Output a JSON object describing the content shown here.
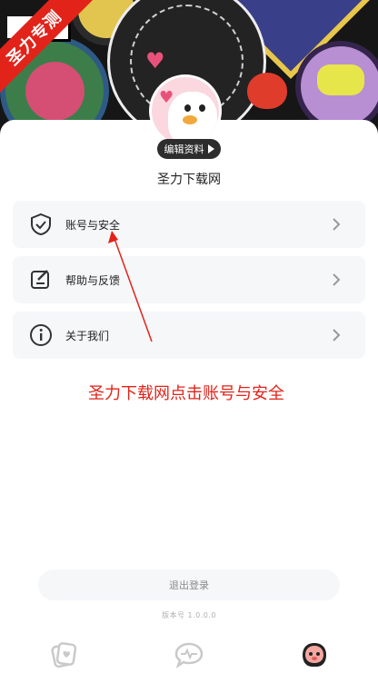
{
  "watermark": {
    "text": "圣力专测",
    "color": "#e2231a"
  },
  "profile": {
    "edit_label": "编辑资料",
    "username": "圣力下载网"
  },
  "menu": [
    {
      "label": "账号与安全",
      "icon": "shield-icon"
    },
    {
      "label": "帮助与反馈",
      "icon": "feedback-edit-icon"
    },
    {
      "label": "关于我们",
      "icon": "info-icon"
    }
  ],
  "annotation": {
    "text": "圣力下载网点击账号与安全",
    "color": "#e2231a"
  },
  "logout_label": "退出登录",
  "version_text": "版本号 1.0.0.0",
  "tabbar": [
    {
      "icon": "cards-heart-icon"
    },
    {
      "icon": "chat-heartbeat-icon"
    },
    {
      "icon": "profile-face-icon",
      "active": true
    }
  ]
}
